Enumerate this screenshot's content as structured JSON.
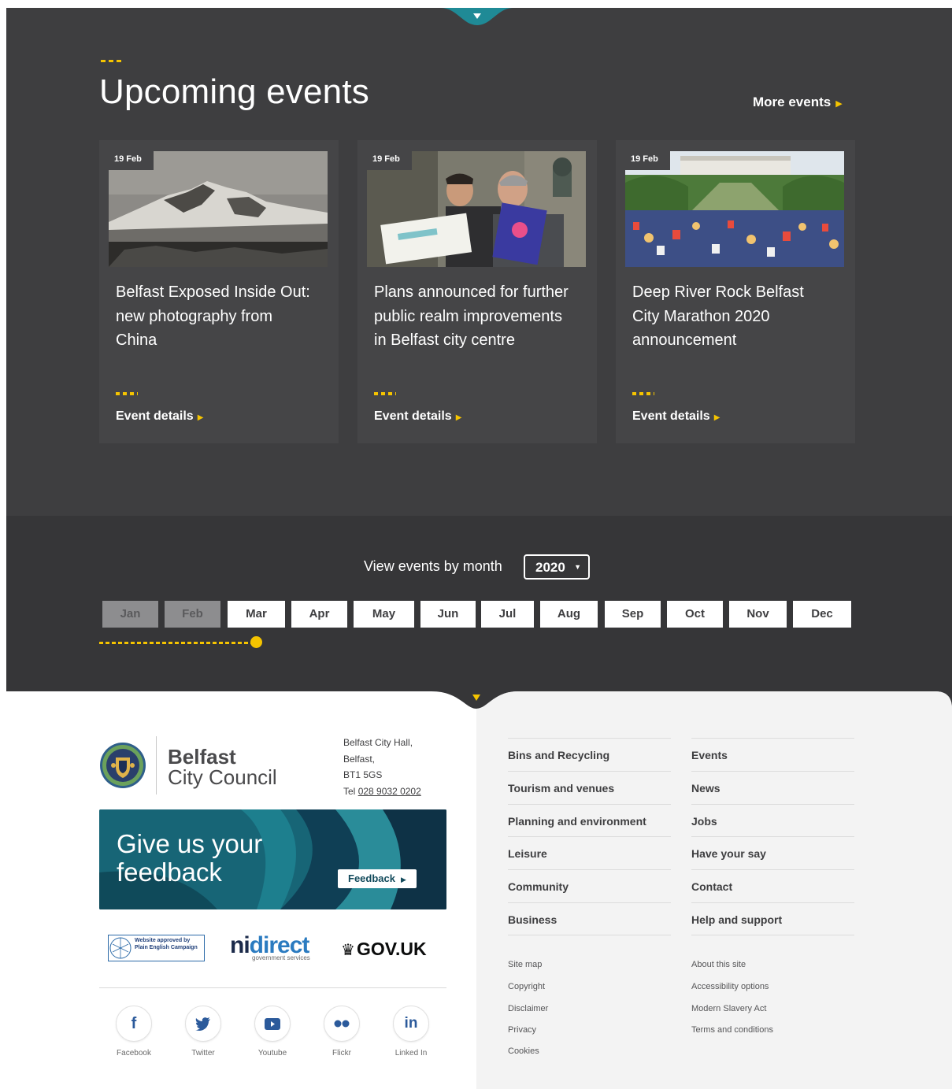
{
  "events": {
    "title": "Upcoming events",
    "more_label": "More events",
    "cards": [
      {
        "date": "19 Feb",
        "title": "Belfast Exposed Inside Out: new photography from China",
        "link": "Event details"
      },
      {
        "date": "19 Feb",
        "title": "Plans announced for further public realm improvements in Belfast city centre",
        "link": "Event details"
      },
      {
        "date": "19 Feb",
        "title": "Deep River Rock Belfast City Marathon 2020 announcement",
        "link": "Event details"
      }
    ]
  },
  "month_filter": {
    "label": "View events by month",
    "year": "2020",
    "months": [
      "Jan",
      "Feb",
      "Mar",
      "Apr",
      "May",
      "Jun",
      "Jul",
      "Aug",
      "Sep",
      "Oct",
      "Nov",
      "Dec"
    ],
    "past_months": 2
  },
  "footer": {
    "logo": {
      "line1": "Belfast",
      "line2": "City Council"
    },
    "address": {
      "line1": "Belfast City Hall,",
      "line2": "Belfast,",
      "line3": "BT1 5GS",
      "tel_prefix": "Tel",
      "tel": "028 9032 0202"
    },
    "feedback": {
      "title": "Give us your feedback",
      "button": "Feedback"
    },
    "partners": {
      "pec": "Website approved by Plain English Campaign",
      "ni": "ni",
      "direct": "direct",
      "ni_sub": "government services",
      "govuk": "GOV.UK"
    },
    "social": [
      {
        "label": "Facebook",
        "icon": "facebook-icon"
      },
      {
        "label": "Twitter",
        "icon": "twitter-icon"
      },
      {
        "label": "Youtube",
        "icon": "youtube-icon"
      },
      {
        "label": "Flickr",
        "icon": "flickr-icon"
      },
      {
        "label": "Linked In",
        "icon": "linkedin-icon"
      }
    ],
    "links_col1": [
      "Bins and Recycling",
      "Tourism and venues",
      "Planning and environment",
      "Leisure",
      "Community",
      "Business"
    ],
    "links_col2": [
      "Events",
      "News",
      "Jobs",
      "Have your say",
      "Contact",
      "Help and support"
    ],
    "small_col1": [
      "Site map",
      "Copyright",
      "Disclaimer",
      "Privacy",
      "Cookies"
    ],
    "small_col2": [
      "About this site",
      "Accessibility options",
      "Modern Slavery Act",
      "Terms and conditions"
    ]
  },
  "colors": {
    "dark_bg": "#3e3e40",
    "accent": "#f5c400",
    "teal": "#1f8a96",
    "footer_right_bg": "#f3f3f3"
  }
}
